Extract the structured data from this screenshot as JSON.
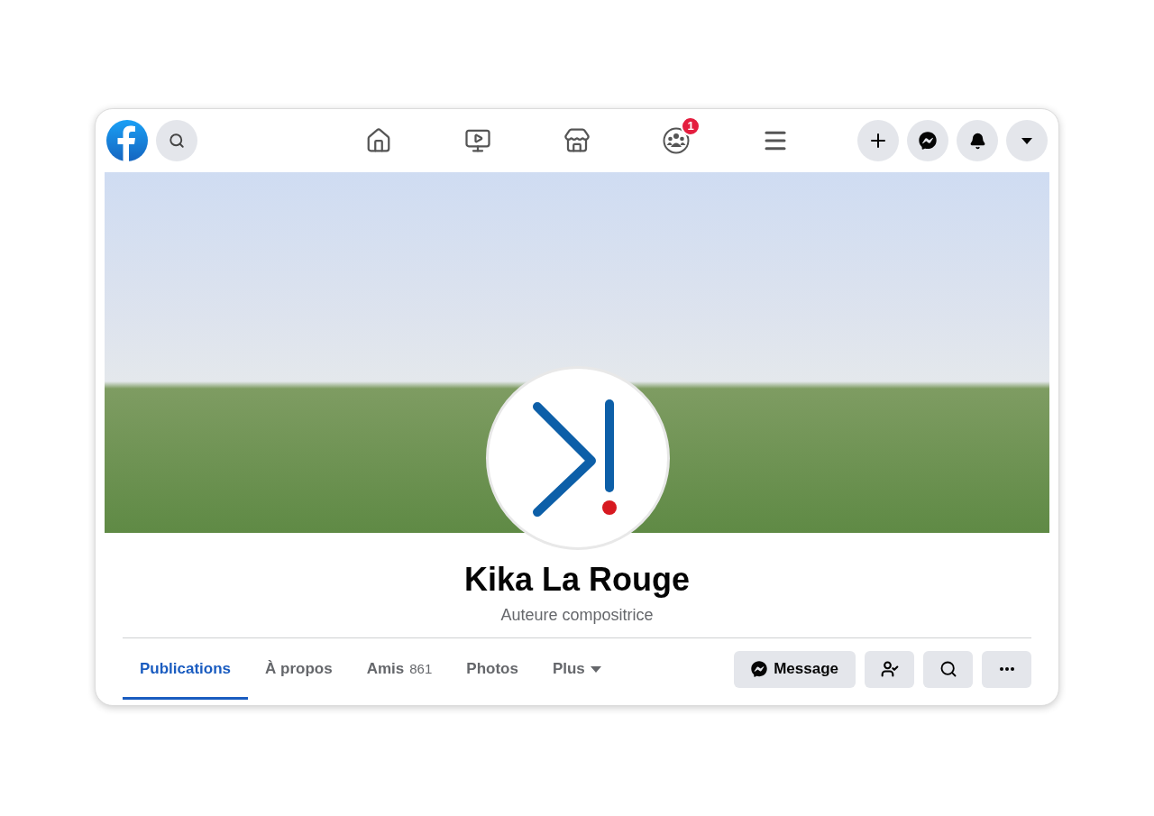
{
  "nav": {
    "notification_badge": "1"
  },
  "profile": {
    "name": "Kika La Rouge",
    "subtitle": "Auteure compositrice"
  },
  "tabs": [
    {
      "label": "Publications",
      "kind": "link",
      "selected": true
    },
    {
      "label": "À propos",
      "kind": "link",
      "selected": false
    },
    {
      "label": "Amis",
      "count": "861",
      "kind": "link",
      "selected": false
    },
    {
      "label": "Photos",
      "kind": "link",
      "selected": false
    },
    {
      "label": "Plus",
      "kind": "menu",
      "selected": false
    }
  ],
  "actions": {
    "message_button": "Message"
  }
}
